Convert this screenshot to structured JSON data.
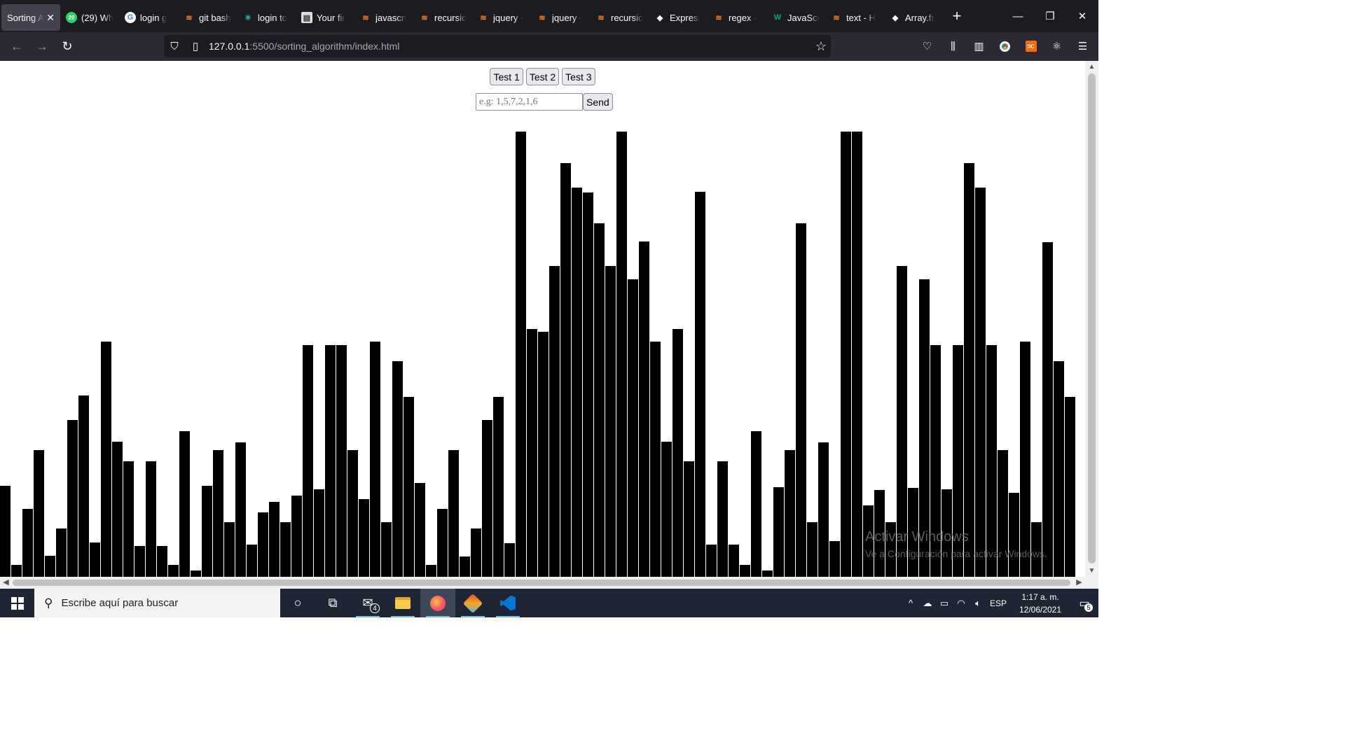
{
  "browser": {
    "tabs": [
      {
        "label": "Sorting A",
        "icon": "page-icon",
        "active": true
      },
      {
        "label": "(29) Wh",
        "icon": "whatsapp-icon",
        "badge": "29"
      },
      {
        "label": "login g",
        "icon": "google-icon"
      },
      {
        "label": "git bash",
        "icon": "stackoverflow-icon"
      },
      {
        "label": "login to",
        "icon": "gitdiagram-icon"
      },
      {
        "label": "Your fir",
        "icon": "document-icon"
      },
      {
        "label": "javascri",
        "icon": "stackoverflow-icon"
      },
      {
        "label": "recursio",
        "icon": "stackoverflow-icon"
      },
      {
        "label": "jquery -",
        "icon": "stackoverflow-icon"
      },
      {
        "label": "jquery -",
        "icon": "stackoverflow-icon"
      },
      {
        "label": "recursio",
        "icon": "stackoverflow-icon"
      },
      {
        "label": "Expresi",
        "icon": "express-icon"
      },
      {
        "label": "regex -",
        "icon": "stackoverflow-icon"
      },
      {
        "label": "JavaScr",
        "icon": "w3schools-icon"
      },
      {
        "label": "text - H",
        "icon": "stackoverflow-icon"
      },
      {
        "label": "Array.fr",
        "icon": "express-icon"
      }
    ],
    "url": {
      "host": "127.0.0.1",
      "path": ":5500/sorting_algorithm/index.html"
    }
  },
  "page": {
    "test_buttons": [
      "Test 1",
      "Test 2",
      "Test 3"
    ],
    "input_placeholder": "e.g: 1,5,7,2,1,6",
    "send_label": "Send",
    "bars": {
      "max_value": 100,
      "values": [
        20.5,
        2.7,
        15.2,
        28.4,
        4.7,
        10.9,
        35.2,
        40.7,
        7.7,
        52.9,
        30.3,
        25.9,
        6.9,
        25.9,
        6.9,
        2.7,
        32.7,
        1.4,
        20.4,
        28.4,
        12.3,
        30.2,
        7.3,
        14.5,
        16.9,
        12.3,
        18.2,
        52.0,
        19.7,
        52.0,
        52.0,
        28.4,
        17.5,
        52.9,
        12.3,
        48.4,
        40.4,
        21.1,
        2.7,
        15.3,
        28.4,
        4.6,
        10.9,
        35.2,
        40.4,
        7.6,
        100,
        55.6,
        55.0,
        69.8,
        93.0,
        87.4,
        86.3,
        79.4,
        69.8,
        100,
        66.9,
        75.3,
        52.9,
        30.3,
        55.6,
        25.9,
        86.4,
        7.2,
        25.9,
        7.2,
        2.7,
        32.7,
        1.4,
        20.2,
        28.4,
        79.4,
        12.3,
        30.2,
        8.0,
        100,
        100,
        16.0,
        19.5,
        12.3,
        69.8,
        20.0,
        66.9,
        52.0,
        19.6,
        52.0,
        93.0,
        87.4,
        52.0,
        28.4,
        18.8,
        52.9,
        12.3,
        75.2,
        48.4,
        40.4
      ]
    }
  },
  "watermark": {
    "title": "Activar Windows",
    "subtitle": "Ve a Configuración para activar Windows."
  },
  "taskbar": {
    "search_placeholder": "Escribe aquí para buscar",
    "mail_badge": "4",
    "language": "ESP",
    "time": "1:17 a. m.",
    "date": "12/06/2021",
    "notification_count": "5"
  }
}
